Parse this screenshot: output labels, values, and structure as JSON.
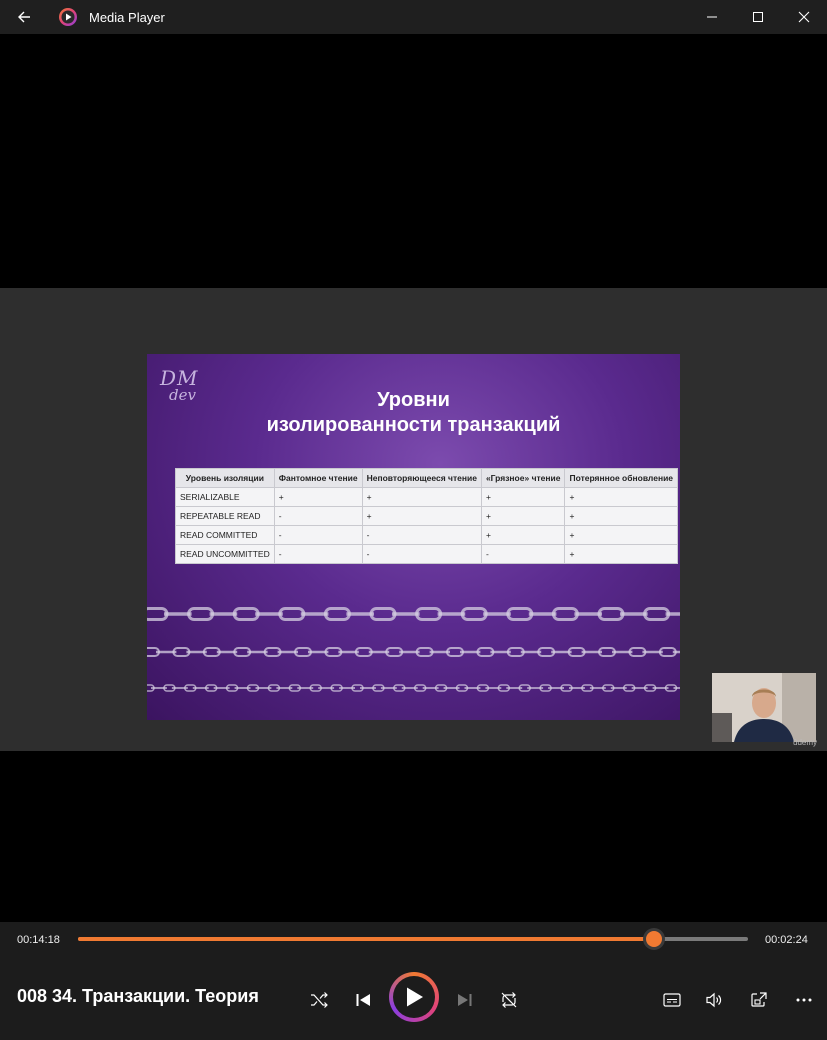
{
  "window": {
    "title": "Media Player"
  },
  "slide": {
    "logo_line1": "DM",
    "logo_line2": "dev",
    "title_line1": "Уровни",
    "title_line2": "изолированности транзакций",
    "table": {
      "headers": [
        "Уровень изоляции",
        "Фантомное чтение",
        "Неповторяющееся чтение",
        "«Грязное» чтение",
        "Потерянное обновление"
      ],
      "rows": [
        [
          "SERIALIZABLE",
          "+",
          "+",
          "+",
          "+"
        ],
        [
          "REPEATABLE READ",
          "-",
          "+",
          "+",
          "+"
        ],
        [
          "READ COMMITTED",
          "-",
          "-",
          "+",
          "+"
        ],
        [
          "READ UNCOMMITTED",
          "-",
          "-",
          "-",
          "+"
        ]
      ]
    }
  },
  "webcam": {
    "watermark": "ûdemy"
  },
  "player": {
    "elapsed": "00:14:18",
    "remaining": "00:02:24",
    "progress_fraction": 0.86,
    "media_title": "008 34. Транзакции. Теория",
    "accent_color": "#f07a32"
  },
  "icons": [
    "back-arrow-icon",
    "media-player-logo-icon",
    "minimize-icon",
    "maximize-icon",
    "close-icon",
    "shuffle-icon",
    "previous-icon",
    "play-icon",
    "next-icon",
    "repeat-icon",
    "subtitles-icon",
    "volume-icon",
    "mini-player-icon",
    "more-icon"
  ]
}
